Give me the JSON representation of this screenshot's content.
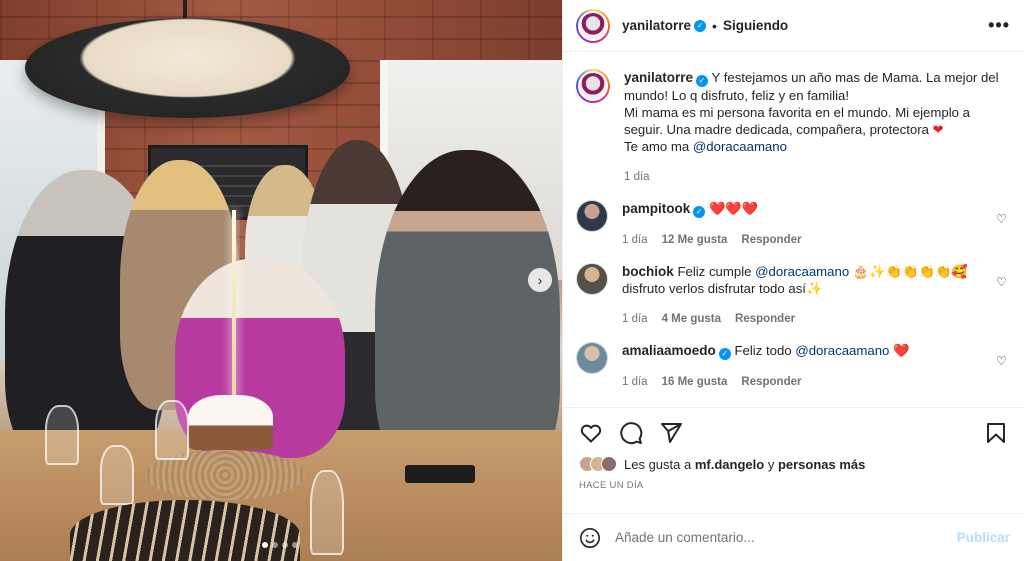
{
  "post": {
    "author": "yanilatorre",
    "follow_status": "Siguiendo",
    "more_icon": "more-horizontal-icon"
  },
  "caption": {
    "author": "yanilatorre",
    "line1": "Y festejamos un año mas de Mama. La mejor del mundo! Lo q disfruto, feliz y en familia!",
    "line2": "Mi mama es mi persona favorita en el mundo. Mi ejemplo a seguir. Una madre dedicada, compañera, protectora",
    "line3_prefix": "Te amo ma",
    "line3_mention": "@doracaamano",
    "time": "1 día"
  },
  "comments": [
    {
      "user": "pampitook",
      "verified": true,
      "text": "",
      "mention": "",
      "emoji": "❤️❤️❤️",
      "extra": "",
      "time": "1 día",
      "likes": "12 Me gusta",
      "reply": "Responder"
    },
    {
      "user": "bochiok",
      "verified": false,
      "text": "Feliz cumple",
      "mention": "@doracaamano",
      "emoji": "🎂✨👏👏👏👏🥰",
      "extra": "disfruto verlos disfrutar todo así✨",
      "time": "1 día",
      "likes": "4 Me gusta",
      "reply": "Responder"
    },
    {
      "user": "amaliaamoedo",
      "verified": true,
      "text": "Feliz todo",
      "mention": "@doracaamano",
      "emoji": "❤️",
      "extra": "",
      "time": "1 día",
      "likes": "16 Me gusta",
      "reply": "Responder"
    }
  ],
  "actions": {
    "likes_prefix": "Les gusta a",
    "likes_user": "mf.dangelo",
    "likes_and": "y",
    "likes_others": "personas más",
    "timestamp": "HACE UN DÍA"
  },
  "add_comment": {
    "placeholder": "Añade un comentario...",
    "publish": "Publicar"
  },
  "carousel": {
    "total": 4,
    "active": 0,
    "next_icon": "chevron-right-icon"
  },
  "colors": {
    "verified": "#0095f6",
    "mention": "#00376b",
    "publish_disabled": "#b2dffc",
    "heart": "#ed1c24"
  }
}
